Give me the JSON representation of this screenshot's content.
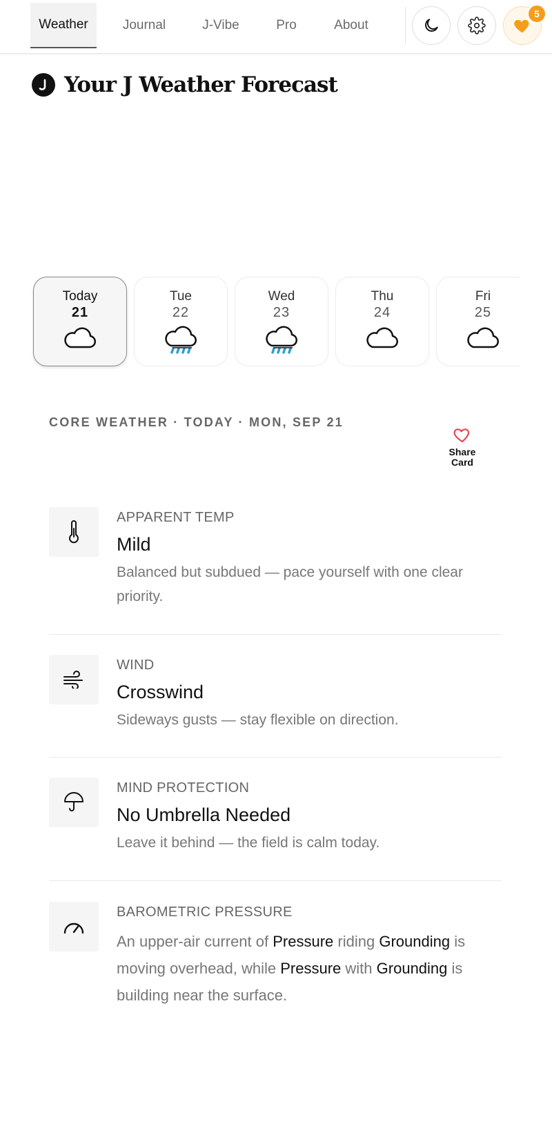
{
  "nav": {
    "tabs": [
      {
        "label": "Weather",
        "active": true
      },
      {
        "label": "Journal",
        "active": false
      },
      {
        "label": "J-Vibe",
        "active": false
      },
      {
        "label": "Pro",
        "active": false
      },
      {
        "label": "About",
        "active": false
      }
    ],
    "theme_icon": "moon-icon",
    "settings_icon": "gear-icon",
    "favorites_icon": "heart-icon",
    "favorites_badge": "5",
    "accent_color": "#f59e1b"
  },
  "header": {
    "logo_letter": "J",
    "title": "Your J Weather Forecast"
  },
  "days": [
    {
      "name": "Today",
      "date": "21",
      "icon": "cloud-icon",
      "active": true
    },
    {
      "name": "Tue",
      "date": "22",
      "icon": "rain-cloud-icon",
      "active": false
    },
    {
      "name": "Wed",
      "date": "23",
      "icon": "rain-cloud-icon",
      "active": false
    },
    {
      "name": "Thu",
      "date": "24",
      "icon": "cloud-icon",
      "active": false
    },
    {
      "name": "Fri",
      "date": "25",
      "icon": "cloud-icon",
      "active": false
    }
  ],
  "core": {
    "header": "CORE WEATHER · TODAY · MON, SEP 21",
    "share_label_1": "Share",
    "share_label_2": "Card",
    "share_color": "#e0454f"
  },
  "items": [
    {
      "icon": "thermometer-icon",
      "label": "APPARENT TEMP",
      "value": "Mild",
      "desc": "Balanced but subdued — pace yourself with one clear priority."
    },
    {
      "icon": "wind-icon",
      "label": "WIND",
      "value": "Crosswind",
      "desc": "Sideways gusts — stay flexible on direction."
    },
    {
      "icon": "umbrella-icon",
      "label": "MIND PROTECTION",
      "value": "No Umbrella Needed",
      "desc": "Leave it behind — the field is calm today."
    },
    {
      "icon": "gauge-icon",
      "label": "BAROMETRIC PRESSURE",
      "rich": [
        {
          "t": "An upper-air current of ",
          "b": false
        },
        {
          "t": "Pressure",
          "b": true
        },
        {
          "t": " riding ",
          "b": false
        },
        {
          "t": "Grounding",
          "b": true
        },
        {
          "t": " is moving overhead, while ",
          "b": false
        },
        {
          "t": "Pressure",
          "b": true
        },
        {
          "t": " with ",
          "b": false
        },
        {
          "t": "Grounding",
          "b": true
        },
        {
          "t": " is building near the surface.",
          "b": false
        }
      ]
    }
  ]
}
